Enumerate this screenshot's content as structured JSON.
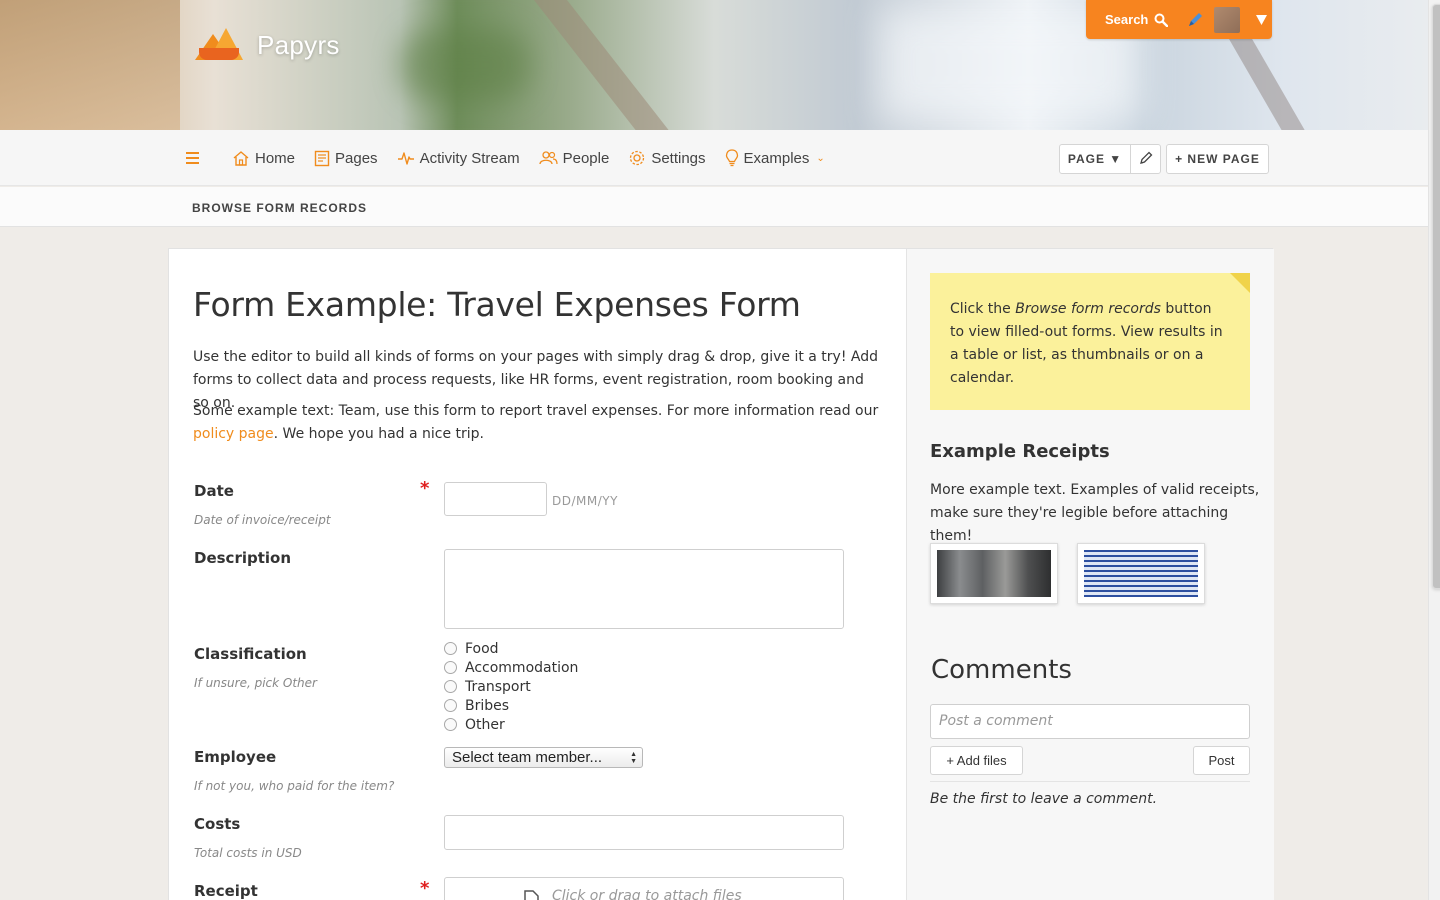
{
  "app": {
    "name": "Papyrs"
  },
  "topbar": {
    "search_label": "Search",
    "dropdown_icon": "caret-down-icon",
    "accent": "#f7841f"
  },
  "nav": {
    "items": [
      {
        "label": "Home",
        "icon": "home-icon"
      },
      {
        "label": "Pages",
        "icon": "pages-icon"
      },
      {
        "label": "Activity Stream",
        "icon": "pulse-icon"
      },
      {
        "label": "People",
        "icon": "people-icon"
      },
      {
        "label": "Settings",
        "icon": "gear-icon"
      },
      {
        "label": "Examples",
        "icon": "lightbulb-icon"
      }
    ],
    "page_button": "PAGE ▼",
    "new_page_button": "+ NEW PAGE"
  },
  "subbar": {
    "label": "BROWSE FORM RECORDS"
  },
  "main": {
    "title": "Form Example: Travel Expenses Form",
    "intro": "Use the editor to build all kinds of forms on your pages with simply drag & drop, give it a try! Add forms to collect data and process requests, like HR forms, event registration, room booking and so on.",
    "text_before_link": "Some example text: Team, use this form to report travel expenses. For more information read our ",
    "link_text": "policy page",
    "text_after_link": ". We hope you had a nice trip."
  },
  "form": {
    "date": {
      "label": "Date",
      "hint": "Date of invoice/receipt",
      "required": "*",
      "format": "DD/MM/YY"
    },
    "description": {
      "label": "Description"
    },
    "classification": {
      "label": "Classification",
      "hint": "If unsure, pick Other",
      "options": [
        "Food",
        "Accommodation",
        "Transport",
        "Bribes",
        "Other"
      ]
    },
    "employee": {
      "label": "Employee",
      "hint": "If not you, who paid for the item?",
      "selected": "Select team member..."
    },
    "costs": {
      "label": "Costs",
      "hint": "Total costs in USD"
    },
    "receipt": {
      "label": "Receipt",
      "required": "*",
      "upload_text": "Click or drag to attach files"
    }
  },
  "sidebar": {
    "note_before": "Click the ",
    "note_em": "Browse form records",
    "note_after": " button to view filled-out forms. View results in a table or list, as thumbnails or on a calendar.",
    "receipts_title": "Example Receipts",
    "receipts_text": "More example text. Examples of valid receipts, make sure they're legible before attaching them!",
    "comments_title": "Comments",
    "comment_placeholder": "Post a comment",
    "add_files": "+ Add files",
    "post": "Post",
    "empty": "Be the first to leave a comment."
  }
}
